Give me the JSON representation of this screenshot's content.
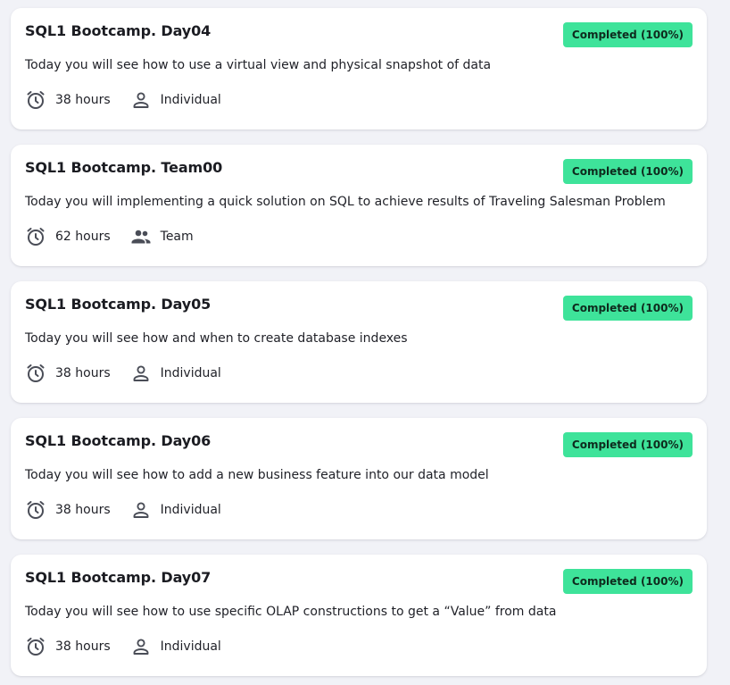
{
  "projects": [
    {
      "title": "SQL1 Bootcamp. Day04",
      "status": "Completed (100%)",
      "description": "Today you will see how to use a virtual view and physical snapshot of data",
      "duration": "38 hours",
      "type": "Individual",
      "type_icon": "person-icon"
    },
    {
      "title": "SQL1 Bootcamp. Team00",
      "status": "Completed (100%)",
      "description": "Today you will implementing a quick solution on SQL to achieve results of Traveling Salesman Problem",
      "duration": "62 hours",
      "type": "Team",
      "type_icon": "team-icon"
    },
    {
      "title": "SQL1 Bootcamp. Day05",
      "status": "Completed (100%)",
      "description": "Today you will see how and when to create database indexes",
      "duration": "38 hours",
      "type": "Individual",
      "type_icon": "person-icon"
    },
    {
      "title": "SQL1 Bootcamp. Day06",
      "status": "Completed (100%)",
      "description": "Today you will see how to add a new business feature into our data model",
      "duration": "38 hours",
      "type": "Individual",
      "type_icon": "person-icon"
    },
    {
      "title": "SQL1 Bootcamp. Day07",
      "status": "Completed (100%)",
      "description": "Today you will see how to use specific OLAP constructions to get a “Value” from data",
      "duration": "38 hours",
      "type": "Individual",
      "type_icon": "person-icon"
    }
  ],
  "colors": {
    "page_background": "#f1f2f7",
    "card_background": "#ffffff",
    "status_completed": "#3ee39a",
    "icon": "#4a4d57"
  }
}
